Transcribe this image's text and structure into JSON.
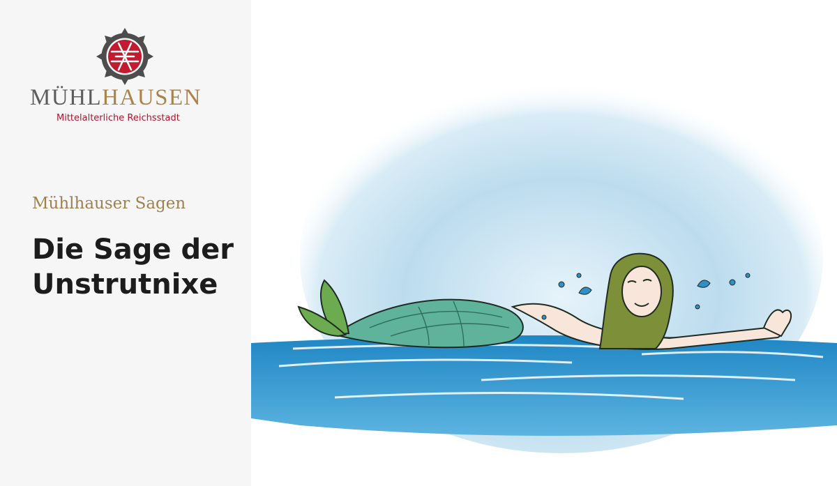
{
  "logo": {
    "word_part1": "MÜHL",
    "word_part2": "HAUSEN",
    "tagline": "Mittelalterliche Reichsstadt",
    "icon": "city-crest-icon"
  },
  "header": {
    "kicker": "Mühlhauser Sagen",
    "title_line1": "Die Sage der",
    "title_line2": "Unstrutnixe"
  },
  "illustration": {
    "subject": "mermaid-swimming-illustration"
  },
  "colors": {
    "kicker": "#9e8151",
    "headline": "#1c1c1c",
    "crest_red": "#c21a2f",
    "crest_grey": "#505050",
    "water": "#2f8fc7",
    "sky": "#c9e2f0",
    "tail": "#5fb39a",
    "hair": "#7e8f3a"
  }
}
